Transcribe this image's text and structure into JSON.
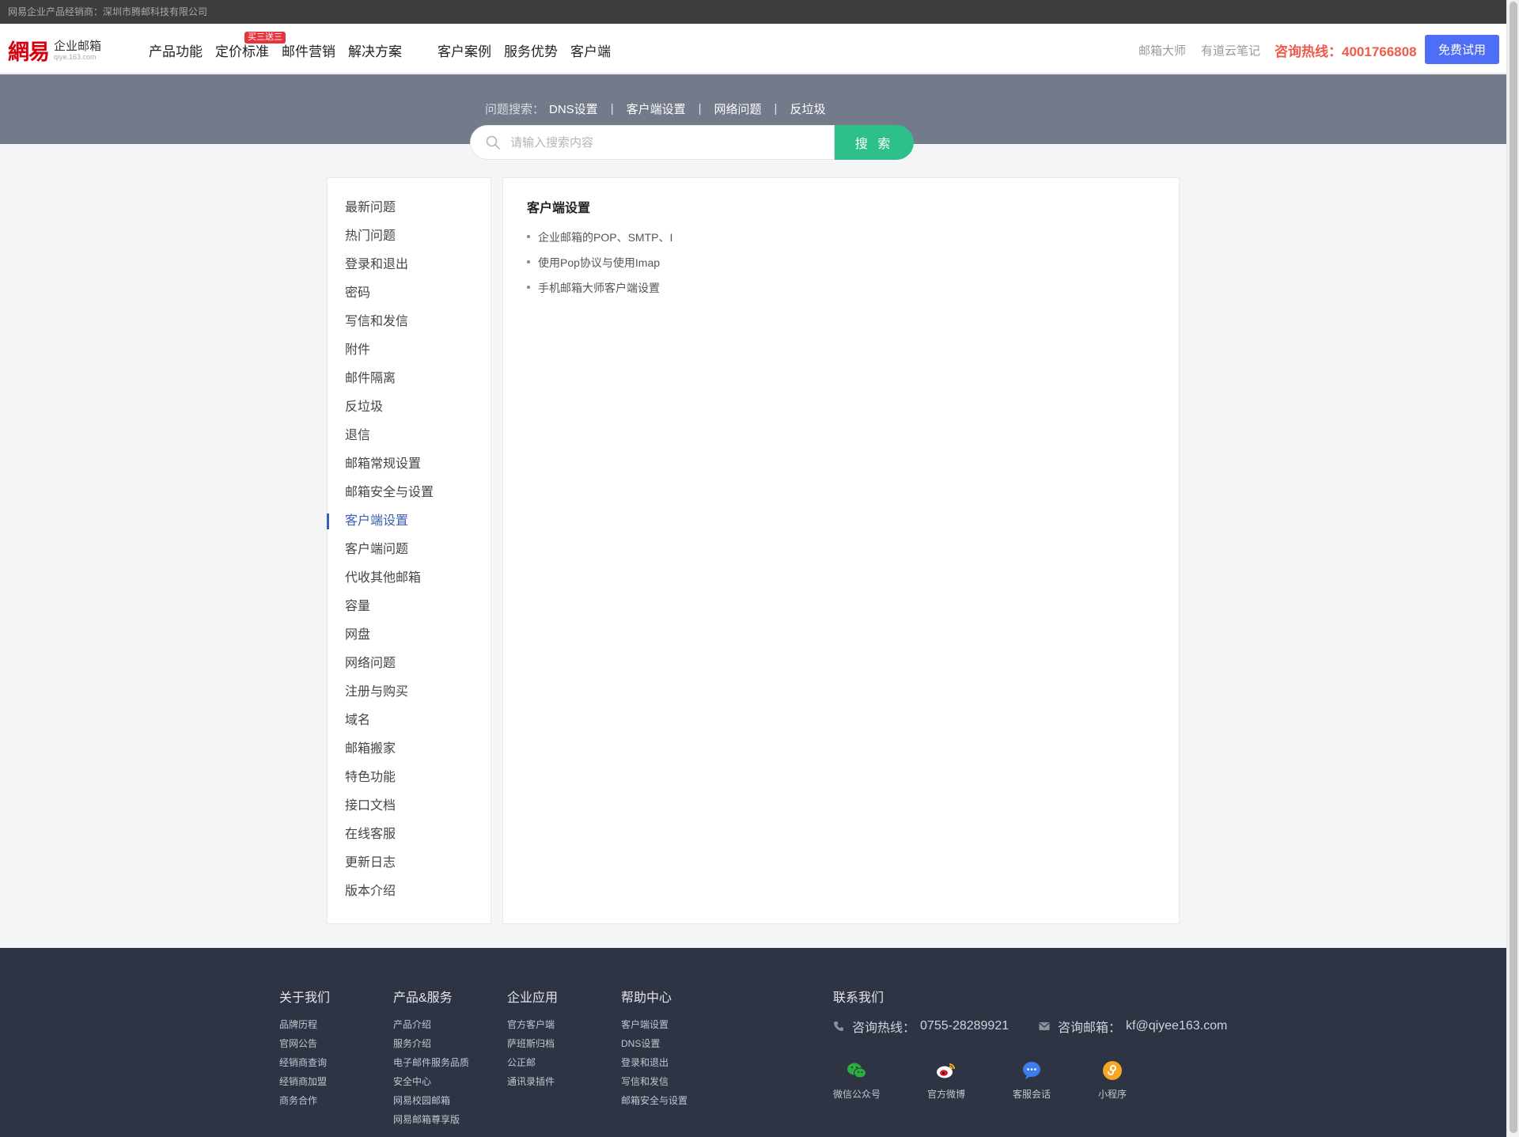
{
  "topbar": {
    "text": "网易企业产品经销商：深圳市腾邮科技有限公司"
  },
  "header": {
    "logo": {
      "mark": "網易",
      "name": "企业邮箱",
      "url": "qiye.163.com"
    },
    "nav": [
      {
        "label": "产品功能"
      },
      {
        "label": "定价标准",
        "badge": "买三送三"
      },
      {
        "label": "邮件营销"
      },
      {
        "label": "解决方案"
      },
      {
        "label": "客户案例"
      },
      {
        "label": "服务优势"
      },
      {
        "label": "客户端"
      }
    ],
    "links": [
      "邮箱大师",
      "有道云笔记"
    ],
    "hotline": "咨询热线：4001766808",
    "trial_button": "免费试用"
  },
  "search": {
    "quick_label": "问题搜索：",
    "quick_links": [
      "DNS设置",
      "客户端设置",
      "网络问题",
      "反垃圾"
    ],
    "separator": "|",
    "placeholder": "请输入搜索内容",
    "button": "搜 索"
  },
  "sidebar": {
    "active_index": 11,
    "items": [
      "最新问题",
      "热门问题",
      "登录和退出",
      "密码",
      "写信和发信",
      "附件",
      "邮件隔离",
      "反垃圾",
      "退信",
      "邮箱常规设置",
      "邮箱安全与设置",
      "客户端设置",
      "客户端问题",
      "代收其他邮箱",
      "容量",
      "网盘",
      "网络问题",
      "注册与购买",
      "域名",
      "邮箱搬家",
      "特色功能",
      "接口文档",
      "在线客服",
      "更新日志",
      "版本介绍"
    ]
  },
  "content": {
    "title": "客户端设置",
    "articles": [
      "企业邮箱的POP、SMTP、I",
      "使用Pop协议与使用Imap",
      "手机邮箱大师客户端设置"
    ]
  },
  "footer": {
    "columns": [
      {
        "title": "关于我们",
        "links": [
          "品牌历程",
          "官网公告",
          "经销商查询",
          "经销商加盟",
          "商务合作"
        ]
      },
      {
        "title": "产品&服务",
        "links": [
          "产品介绍",
          "服务介绍",
          "电子邮件服务品质",
          "安全中心",
          "网易校园邮箱",
          "网易邮箱尊享版"
        ]
      },
      {
        "title": "企业应用",
        "links": [
          "官方客户端",
          "萨班斯归档",
          "公正邮",
          "通讯录插件"
        ]
      },
      {
        "title": "帮助中心",
        "links": [
          "客户端设置",
          "DNS设置",
          "登录和退出",
          "写信和发信",
          "邮箱安全与设置"
        ]
      }
    ],
    "contact": {
      "title": "联系我们",
      "phone_label": "咨询热线：",
      "phone": "0755-28289921",
      "email_label": "咨询邮箱：",
      "email": "kf@qiyee163.com"
    },
    "social": [
      {
        "label": "微信公众号",
        "icon": "wechat-icon",
        "color": "#2aae3c"
      },
      {
        "label": "官方微博",
        "icon": "weibo-icon",
        "color": "#ffffff"
      },
      {
        "label": "客服会话",
        "icon": "chat-icon",
        "color": "#3d7cf0"
      },
      {
        "label": "小程序",
        "icon": "mini-program-icon",
        "color": "#f5a623"
      }
    ]
  },
  "colors": {
    "accent": "#4d6ef5",
    "search_button": "#2ec08a",
    "hotline": "#f05a4a",
    "active": "#3a5fb0"
  }
}
